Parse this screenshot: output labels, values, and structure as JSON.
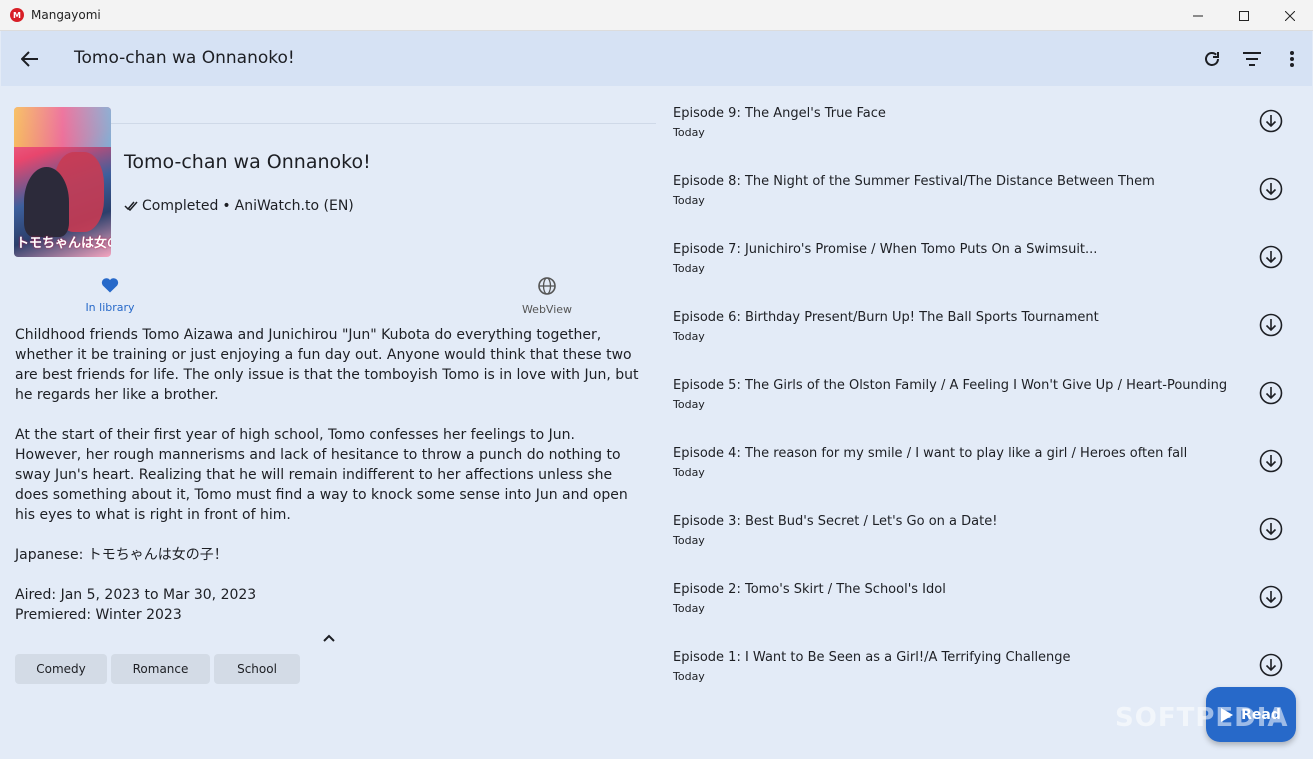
{
  "window": {
    "app_logo_text": "M",
    "app_title": "Mangayomi"
  },
  "appbar": {
    "title": "Tomo-chan wa Onnanoko!",
    "actions": [
      "refresh-icon",
      "filter-icon",
      "more-vert-icon"
    ]
  },
  "detail": {
    "cover_text": "トモちゃんは女の子",
    "title": "Tomo-chan wa Onnanoko!",
    "status": "Completed",
    "separator": "•",
    "source": "AniWatch.to (EN)",
    "actions": {
      "library_label": "In library",
      "webview_label": "WebView"
    },
    "description": [
      "Childhood friends Tomo Aizawa and Junichirou \"Jun\" Kubota do everything together, whether it be training or just enjoying a fun day out. Anyone would think that these two are best friends for life. The only issue is that the tomboyish Tomo is in love with Jun, but he regards her like a brother.",
      "At the start of their first year of high school, Tomo confesses her feelings to Jun. However, her rough mannerisms and lack of hesitance to throw a punch do nothing to sway Jun's heart. Realizing that he will remain indifferent to her affections unless she does something about it, Tomo must find a way to knock some sense into Jun and open his eyes to what is right in front of him.",
      "Japanese: トモちゃんは女の子！",
      "Aired: Jan 5, 2023 to Mar 30, 2023",
      "Premiered: Winter 2023"
    ],
    "genres": [
      "Comedy",
      "Romance",
      "School"
    ]
  },
  "episodes": [
    {
      "title": "Episode 9: The Angel's True Face",
      "date": "Today"
    },
    {
      "title": "Episode 8: The Night of the Summer Festival/The Distance Between Them",
      "date": "Today"
    },
    {
      "title": "Episode 7: Junichiro's Promise / When Tomo Puts On a Swimsuit...",
      "date": "Today"
    },
    {
      "title": "Episode 6: Birthday Present/Burn Up! The Ball Sports Tournament",
      "date": "Today"
    },
    {
      "title": "Episode 5: The Girls of the Olston Family / A Feeling I Won't Give Up / Heart-Pounding",
      "date": "Today"
    },
    {
      "title": "Episode 4: The reason for my smile / I want to play like a girl / Heroes often fall",
      "date": "Today"
    },
    {
      "title": "Episode 3: Best Bud's Secret / Let's Go on a Date!",
      "date": "Today"
    },
    {
      "title": "Episode 2: Tomo's Skirt / The School's Idol",
      "date": "Today"
    },
    {
      "title": "Episode 1: I Want to Be Seen as a Girl!/A Terrifying Challenge",
      "date": "Today"
    }
  ],
  "fab": {
    "read_label": "Read"
  },
  "watermark": "SOFTPEDIA",
  "colors": {
    "background": "#e3ebf7",
    "appbar": "#d6e2f4",
    "accent": "#2769c9",
    "chip": "#d3dbe6",
    "brand": "#d81f26"
  }
}
